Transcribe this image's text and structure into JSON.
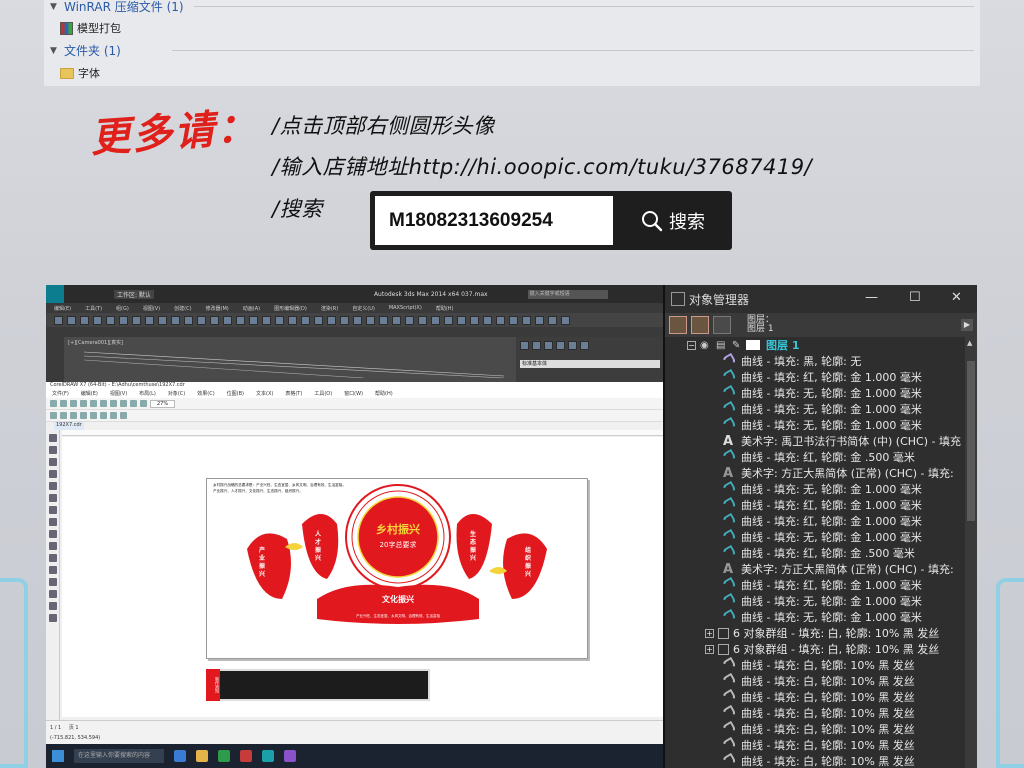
{
  "file_groups": [
    {
      "title": "WinRAR 压缩文件 (1)",
      "items": [
        "模型打包"
      ]
    },
    {
      "title": "文件夹 (1)",
      "items": [
        "字体"
      ]
    }
  ],
  "promo": {
    "heading": "更多请：",
    "line1": "/点击顶部右侧圆形头像",
    "line2": "/输入店铺地址http://hi.ooopic.com/tuku/37687419/",
    "line3": "/搜索",
    "search_value": "M18082313609254",
    "search_button": "搜索"
  },
  "max": {
    "title": "Autodesk 3ds Max  2014 x64         037.max",
    "workspace": "工作区: 默认",
    "search_placeholder": "键入关键字或短语",
    "menu": [
      "编辑(E)",
      "工具(T)",
      "组(G)",
      "视图(V)",
      "创建(C)",
      "修改器(M)",
      "动画(A)",
      "图形编辑器(D)",
      "渲染(R)",
      "自定义(U)",
      "MAXScript(X)",
      "帮助(H)"
    ],
    "viewport_label": "[+][Camera001][真实]",
    "cmd_label": "标准基本体"
  },
  "corel": {
    "title": "CorelDRAW X7 (64-Bit) - E:\\Adhu\\cemthuse\\192X7.cdr",
    "menu": [
      "文件(F)",
      "编辑(E)",
      "视图(V)",
      "布局(L)",
      "对象(C)",
      "效果(C)",
      "位图(B)",
      "文本(X)",
      "表格(T)",
      "工具(O)",
      "窗口(W)",
      "帮助(H)"
    ],
    "doc_tab": "192X7.cdr",
    "zoom": "27%",
    "status_left": "(-715.821, 534.594)",
    "page_tab": "页 1",
    "page_num": "1 / 1",
    "taskbar_search": "在这里输入你要搜索的内容"
  },
  "artwork": {
    "center_title": "乡村振兴",
    "center_sub": "20字总要求",
    "petal_1": "产业振兴",
    "petal_2": "人才振兴",
    "petal_3": "生态振兴",
    "petal_4": "组织振兴",
    "bottom_title": "文化振兴",
    "bottom_sub": "产业兴旺、生态宜居、乡风文明、治理有效、生活富裕",
    "page_note_1": "乡村振兴战略的总要求是：产业兴旺、生态宜居、乡风文明、治理有效、生活富裕。",
    "page_note_2": "产业振兴、人才振兴、文化振兴、生态振兴、组织振兴。",
    "panel_tag": "制作须知"
  },
  "object_manager": {
    "title": "对象管理器",
    "page_label_1": "图层：",
    "page_label_2": "图层 1",
    "layer_name": "图层 1",
    "rows": [
      {
        "type": "curve-purple",
        "text": "曲线 - 填充: 黑, 轮廓: 无",
        "indent": 58
      },
      {
        "type": "curve",
        "text": "曲线 - 填充: 红, 轮廓: 金  1.000 毫米",
        "indent": 58
      },
      {
        "type": "curve",
        "text": "曲线 - 填充: 无, 轮廓: 金  1.000 毫米",
        "indent": 58
      },
      {
        "type": "curve",
        "text": "曲线 - 填充: 无, 轮廓: 金  1.000 毫米",
        "indent": 58
      },
      {
        "type": "curve",
        "text": "曲线 - 填充: 无, 轮廓: 金  1.000 毫米",
        "indent": 58
      },
      {
        "type": "text",
        "text": "美术字:  禹卫书法行书简体 (中) (CHC) - 填充",
        "indent": 58
      },
      {
        "type": "curve",
        "text": "曲线 - 填充: 红, 轮廓: 金  .500 毫米",
        "indent": 58
      },
      {
        "type": "text-dim",
        "text": "美术字:  方正大黑简体 (正常) (CHC) - 填充:",
        "indent": 58
      },
      {
        "type": "curve",
        "text": "曲线 - 填充: 无, 轮廓: 金  1.000 毫米",
        "indent": 58
      },
      {
        "type": "curve",
        "text": "曲线 - 填充: 红, 轮廓: 金  1.000 毫米",
        "indent": 58
      },
      {
        "type": "curve",
        "text": "曲线 - 填充: 红, 轮廓: 金  1.000 毫米",
        "indent": 58
      },
      {
        "type": "curve",
        "text": "曲线 - 填充: 无, 轮廓: 金  1.000 毫米",
        "indent": 58
      },
      {
        "type": "curve",
        "text": "曲线 - 填充: 红, 轮廓: 金  .500 毫米",
        "indent": 58
      },
      {
        "type": "text-dim",
        "text": "美术字:  方正大黑简体 (正常) (CHC) - 填充:",
        "indent": 58
      },
      {
        "type": "curve",
        "text": "曲线 - 填充: 红, 轮廓: 金  1.000 毫米",
        "indent": 58
      },
      {
        "type": "curve",
        "text": "曲线 - 填充: 无, 轮廓: 金  1.000 毫米",
        "indent": 58
      },
      {
        "type": "curve",
        "text": "曲线 - 填充: 无, 轮廓: 金  1.000 毫米",
        "indent": 58
      },
      {
        "type": "group",
        "text": "6 对象群组 - 填充: 白, 轮廓: 10% 黑 发丝",
        "indent": 40
      },
      {
        "type": "group",
        "text": "6 对象群组 - 填充: 白, 轮廓: 10% 黑 发丝",
        "indent": 40
      },
      {
        "type": "line",
        "text": "曲线 - 填充: 白, 轮廓: 10% 黑 发丝",
        "indent": 58
      },
      {
        "type": "line",
        "text": "曲线 - 填充: 白, 轮廓: 10% 黑 发丝",
        "indent": 58
      },
      {
        "type": "line",
        "text": "曲线 - 填充: 白, 轮廓: 10% 黑 发丝",
        "indent": 58
      },
      {
        "type": "line",
        "text": "曲线 - 填充: 白, 轮廓: 10% 黑 发丝",
        "indent": 58
      },
      {
        "type": "line",
        "text": "曲线 - 填充: 白, 轮廓: 10% 黑 发丝",
        "indent": 58
      },
      {
        "type": "line",
        "text": "曲线 - 填充: 白, 轮廓: 10% 黑 发丝",
        "indent": 58
      },
      {
        "type": "line",
        "text": "曲线 - 填充: 白, 轮廓: 10% 黑 发丝",
        "indent": 58
      },
      {
        "type": "line",
        "text": "曲线 - 填充: 白, 轮廓: 10% 黑 发丝",
        "indent": 58
      },
      {
        "type": "line",
        "text": "曲线 - 填充: 白, 轮廓: 10% 黑 发丝",
        "indent": 58
      }
    ]
  },
  "colors": {
    "accent_red": "#e1191f",
    "layer_cyan": "#34c6d8",
    "gold": "#f5d33a"
  }
}
